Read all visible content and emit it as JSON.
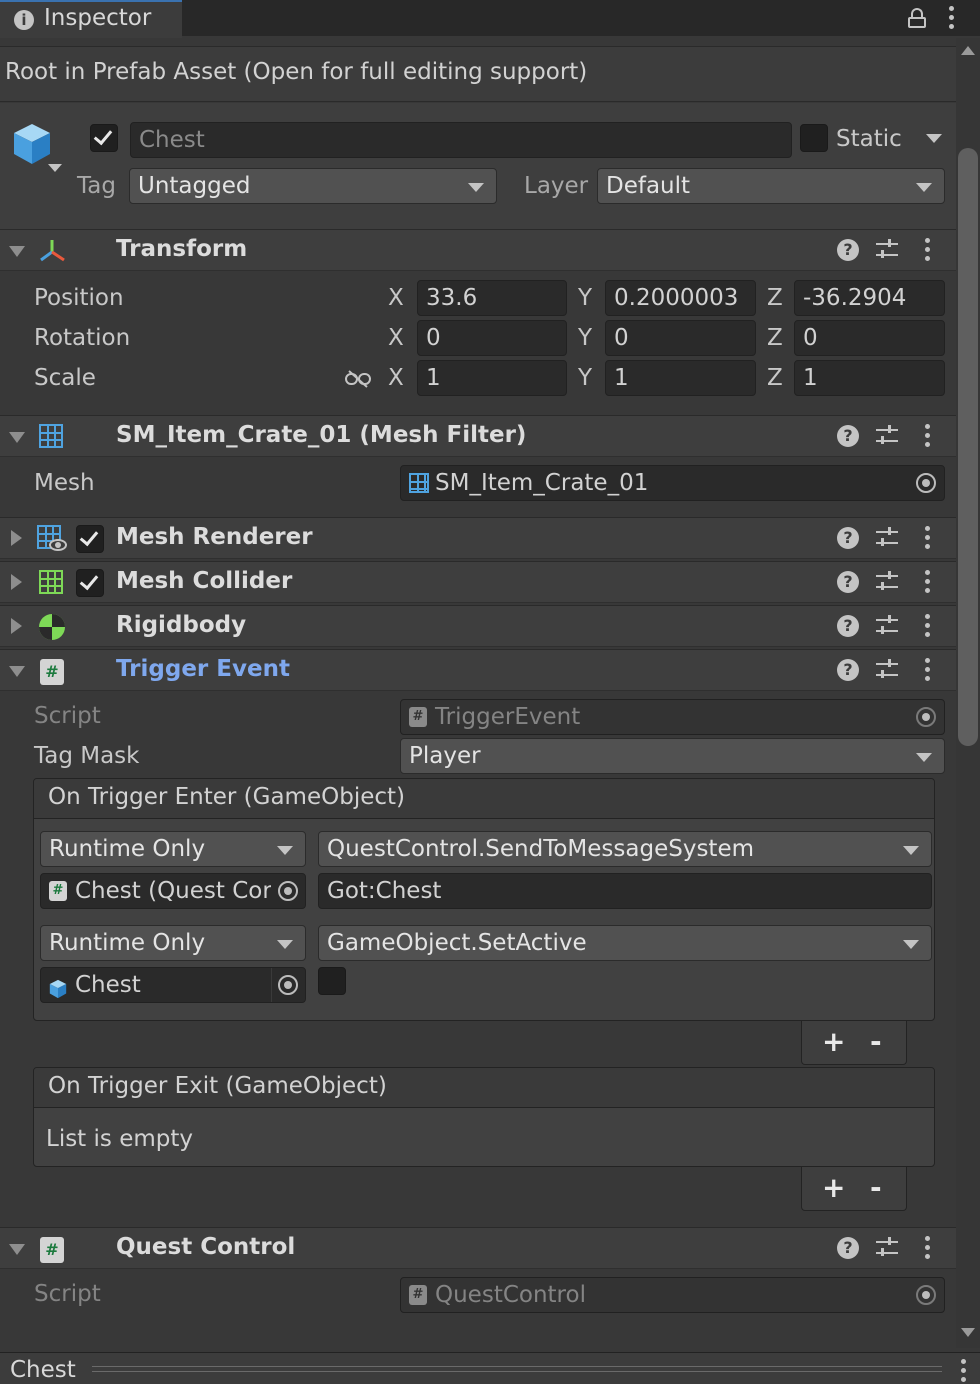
{
  "window": {
    "tab_title": "Inspector",
    "notice": "Root in Prefab Asset (Open for full editing support)"
  },
  "gameobject": {
    "active": true,
    "name": "Chest",
    "static_label": "Static",
    "static": false,
    "tag_label": "Tag",
    "tag_value": "Untagged",
    "layer_label": "Layer",
    "layer_value": "Default"
  },
  "transform": {
    "title": "Transform",
    "rows": [
      {
        "label": "Position",
        "x": "33.6",
        "y": "0.2000003",
        "z": "-36.2904"
      },
      {
        "label": "Rotation",
        "x": "0",
        "y": "0",
        "z": "0"
      },
      {
        "label": "Scale",
        "x": "1",
        "y": "1",
        "z": "1"
      }
    ],
    "axis_x": "X",
    "axis_y": "Y",
    "axis_z": "Z"
  },
  "mesh_filter": {
    "title": "SM_Item_Crate_01 (Mesh Filter)",
    "mesh_label": "Mesh",
    "mesh_value": "SM_Item_Crate_01"
  },
  "collapsed_components": [
    {
      "title": "Mesh Renderer",
      "enabled": true
    },
    {
      "title": "Mesh Collider",
      "enabled": true
    },
    {
      "title": "Rigidbody"
    }
  ],
  "trigger_event": {
    "title": "Trigger Event",
    "title_color": "#7fa8ee",
    "script_label": "Script",
    "script_value": "TriggerEvent",
    "tag_mask_label": "Tag Mask",
    "tag_mask_value": "Player",
    "on_enter": {
      "header": "On Trigger Enter (GameObject)",
      "entries": [
        {
          "mode": "Runtime Only",
          "function": "QuestControl.SendToMessageSystem",
          "target": "Chest (Quest Cor",
          "arg": "Got:Chest"
        },
        {
          "mode": "Runtime Only",
          "function": "GameObject.SetActive",
          "target": "Chest",
          "arg_bool": false
        }
      ]
    },
    "on_exit": {
      "header": "On Trigger Exit (GameObject)",
      "empty_text": "List is empty"
    },
    "plus": "+",
    "minus": "-"
  },
  "quest_control": {
    "title": "Quest Control",
    "script_label": "Script",
    "script_value": "QuestControl"
  },
  "footer": {
    "title": "Chest"
  }
}
